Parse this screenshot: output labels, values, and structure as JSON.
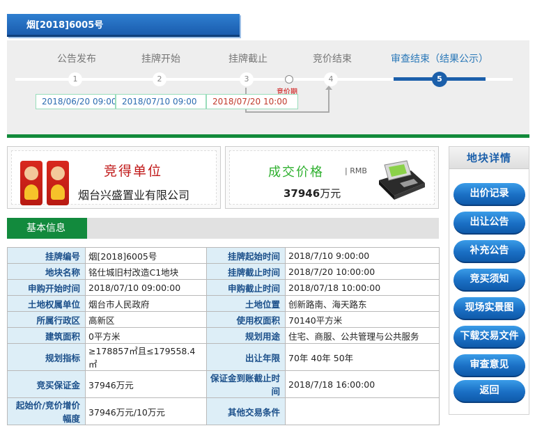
{
  "header": {
    "title": "烟[2018]6005号"
  },
  "steps": [
    {
      "label": "公告发布",
      "num": "1",
      "active": false
    },
    {
      "label": "挂牌开始",
      "num": "2",
      "active": false
    },
    {
      "label": "挂牌截止",
      "num": "3",
      "active": false
    },
    {
      "label": "竞价结束",
      "num": "4",
      "active": false
    },
    {
      "label": "审查结束（结果公示）",
      "num": "5",
      "active": true
    }
  ],
  "bid_period_label": "竞价期",
  "dates": [
    "2018/06/20 09:00",
    "2018/07/10 09:00",
    "2018/07/20 10:00"
  ],
  "colors": {
    "accent_blue": "#1b5faa",
    "accent_green": "#118a3a",
    "red": "#c01818",
    "date_red": "#c0392b",
    "date_blue": "#2a6bb0"
  },
  "winner": {
    "title": "竞得单位",
    "name": "烟台兴盛置业有限公司"
  },
  "price": {
    "title": "成交价格",
    "currency": "RMB",
    "amount": "37946",
    "unit": "万元"
  },
  "section": {
    "title": "基本信息"
  },
  "table": {
    "rows": [
      {
        "l1": "挂牌编号",
        "v1": "烟[2018]6005号",
        "l2": "挂牌起始时间",
        "v2": "2018/7/10 9:00:00"
      },
      {
        "l1": "地块名称",
        "v1": "铭仕城旧村改造C1地块",
        "l2": "挂牌截止时间",
        "v2": "2018/7/20 10:00:00"
      },
      {
        "l1": "申购开始时间",
        "v1": "2018/07/10 09:00:00",
        "l2": "申购截止时间",
        "v2": "2018/07/18 10:00:00"
      },
      {
        "l1": "土地权属单位",
        "v1": "烟台市人民政府",
        "l2": "土地位置",
        "v2": "创新路南、海天路东"
      },
      {
        "l1": "所属行政区",
        "v1": "高新区",
        "l2": "使用权面积",
        "v2": "70140平方米"
      },
      {
        "l1": "建筑面积",
        "v1": "0平方米",
        "l2": "规划用途",
        "v2": "住宅、商服、公共管理与公共服务"
      },
      {
        "l1": "规划指标",
        "v1": "≥178857㎡且≤179558.4㎡",
        "l2": "出让年限",
        "v2": "70年 40年 50年"
      },
      {
        "l1": "竞买保证金",
        "v1": "37946万元",
        "l2": "保证金到账截止时间",
        "v2": "2018/7/18 16:00:00"
      },
      {
        "l1": "起始价/竞价增价幅度",
        "v1": "37946万元/10万元",
        "l2": "其他交易条件",
        "v2": ""
      }
    ]
  },
  "sidebar": {
    "title": "地块详情",
    "buttons": [
      "出价记录",
      "出让公告",
      "补充公告",
      "竞买须知",
      "现场实景图",
      "下载交易文件",
      "审查意见",
      "返回"
    ]
  }
}
